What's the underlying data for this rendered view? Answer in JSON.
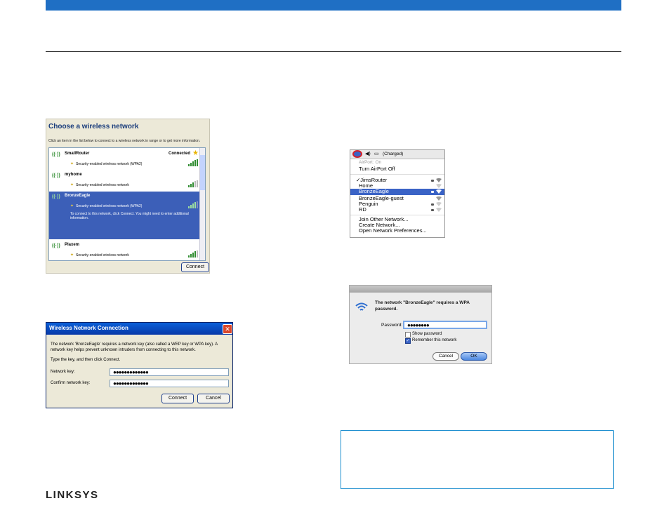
{
  "brand": {
    "logo": "LINKSYS",
    "accent": "#1f6fc4"
  },
  "xp_list": {
    "title": "Choose a wireless network",
    "instructions": "Click an item in the list below to connect to a wireless network in range or to get more information.",
    "networks": [
      {
        "name": "SmallRouter",
        "status": "Connected",
        "security": "Security-enabled wireless network (WPA2)",
        "selected": false
      },
      {
        "name": "myhome",
        "status": "",
        "security": "Security-enabled wireless network",
        "selected": false
      },
      {
        "name": "BronzeEagle",
        "status": "",
        "security": "Security-enabled wireless network (WPA2)",
        "detail": "To connect to this network, click Connect. You might need to enter additional information.",
        "selected": true
      },
      {
        "name": "Plaxem",
        "status": "",
        "security": "Security-enabled wireless network",
        "selected": false
      }
    ],
    "connect_label": "Connect"
  },
  "xp_key": {
    "title": "Wireless Network Connection",
    "message": "The network 'BronzeEagle' requires a network key (also called a WEP key or WPA key). A network key helps prevent unknown intruders from connecting to this network.",
    "prompt": "Type the key, and then click Connect.",
    "key_label": "Network key:",
    "confirm_label": "Confirm network key:",
    "key_value": "●●●●●●●●●●●●●",
    "confirm_value": "●●●●●●●●●●●●●",
    "connect_label": "Connect",
    "cancel_label": "Cancel"
  },
  "mac_menu": {
    "menubar_extra": "(Charged)",
    "airport_status": "AirPort: On",
    "turn_off": "Turn AirPort Off",
    "networks": [
      {
        "name": "✓JimsRouter",
        "lock": true,
        "selected": false
      },
      {
        "name": "Home",
        "lock": false,
        "selected": false
      },
      {
        "name": "BronzeEagle",
        "lock": true,
        "selected": true
      },
      {
        "name": "BronzeEagle-guest",
        "lock": false,
        "selected": false
      },
      {
        "name": "Penguin",
        "lock": true,
        "selected": false
      },
      {
        "name": "RD",
        "lock": true,
        "selected": false
      }
    ],
    "join_other": "Join Other Network...",
    "create": "Create Network...",
    "open_prefs": "Open Network Preferences..."
  },
  "mac_password": {
    "message": "The network \"BronzeEagle\" requires a WPA password.",
    "password_label": "Password:",
    "password_value": "●●●●●●●●",
    "show_password": "Show password",
    "remember": "Remember this network",
    "show_checked": false,
    "remember_checked": true,
    "cancel_label": "Cancel",
    "ok_label": "OK"
  }
}
